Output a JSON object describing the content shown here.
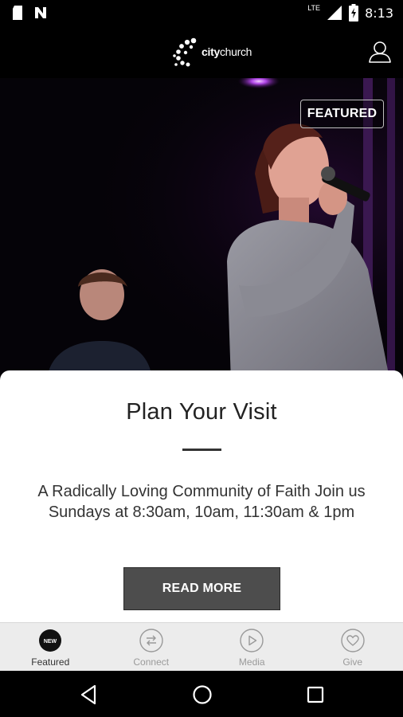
{
  "status_bar": {
    "time": "8:13",
    "network": "LTE",
    "icons": [
      "sd-card-icon",
      "notification-n-icon",
      "signal-icon",
      "battery-icon"
    ]
  },
  "header": {
    "logo_prefix": "city",
    "logo_suffix": "church",
    "profile_icon": "person-icon"
  },
  "hero": {
    "badge": "FEATURED"
  },
  "card": {
    "title": "Plan Your Visit",
    "description": "A Radically Loving Community of Faith Join us Sundays at 8:30am, 10am, 11:30am & 1pm",
    "button": "READ MORE"
  },
  "tabs": [
    {
      "label": "Featured",
      "icon": "new-badge-icon",
      "active": true,
      "badge": "NEW"
    },
    {
      "label": "Connect",
      "icon": "exchange-arrows-icon",
      "active": false
    },
    {
      "label": "Media",
      "icon": "play-icon",
      "active": false
    },
    {
      "label": "Give",
      "icon": "heart-icon",
      "active": false
    }
  ],
  "nav_bar": [
    "back-icon",
    "home-icon",
    "recents-icon"
  ],
  "colors": {
    "card_bg": "#ffffff",
    "button_bg": "#4d4d4d",
    "tab_bar_bg": "#ececec",
    "tab_inactive": "#9a9a9a",
    "stage_light": "#c34dff"
  }
}
